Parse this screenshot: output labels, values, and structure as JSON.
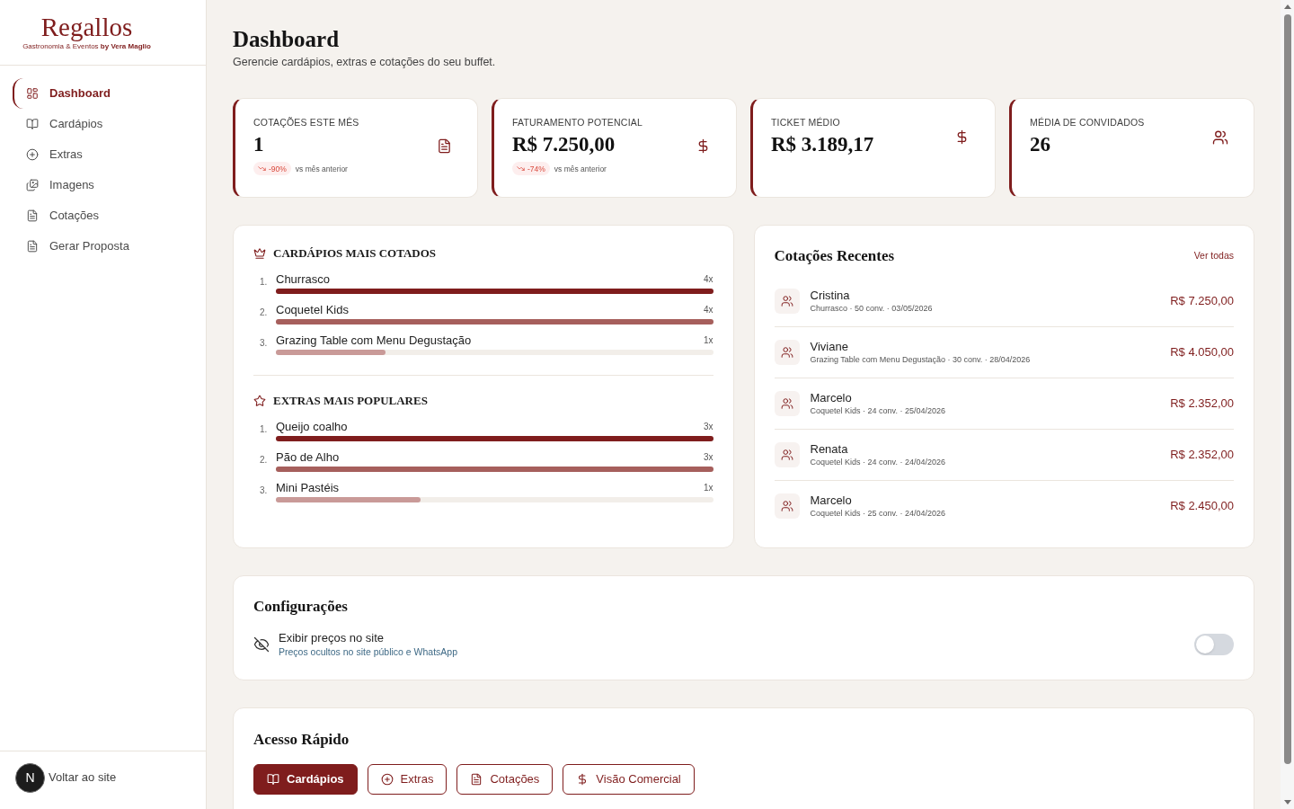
{
  "sidebar": {
    "logo": {
      "name": "Regallos",
      "tagline": "Gastronomia & Eventos **by Vera Maglio**"
    },
    "nav_items": [
      {
        "label": "Dashboard",
        "selected": true
      },
      {
        "label": "Cardápios",
        "selected": false
      },
      {
        "label": "Extras",
        "selected": false
      },
      {
        "label": "Imagens",
        "selected": false
      },
      {
        "label": "Cotações",
        "selected": false
      },
      {
        "label": "Gerar Proposta",
        "selected": false
      }
    ],
    "footer": {
      "back_link": "Voltar ao site"
    }
  },
  "dev_badge": "N",
  "header": {
    "title": "Dashboard",
    "subtitle": "Gerencie cardápios, extras e cotações do seu buffet."
  },
  "stat_cards": [
    {
      "kind": "quotes",
      "label": "COTAÇÕES ESTE MÊS",
      "value": "1",
      "change": "-90%",
      "change_caption": "vs mês anterior"
    },
    {
      "kind": "revenue",
      "label": "FATURAMENTO POTENCIAL",
      "value": "R$ 7.250,00",
      "change": "-74%",
      "change_caption": "vs mês anterior"
    },
    {
      "kind": "ticket",
      "label": "TICKET MÉDIO",
      "value": "R$ 3.189,17"
    },
    {
      "kind": "guests",
      "label": "MÉDIA DE CONVIDADOS",
      "value": "26"
    }
  ],
  "rankings": [
    {
      "kind": "menus",
      "title": "CARDÁPIOS MAIS COTADOS",
      "items": [
        {
          "rank": "1.",
          "name": "Churrasco",
          "count": "4x",
          "level": 1
        },
        {
          "rank": "2.",
          "name": "Coquetel Kids",
          "count": "4x",
          "level": 1
        },
        {
          "rank": "3.",
          "name": "Grazing Table com Menu Degustação",
          "count": "1x",
          "level": 0.25
        }
      ]
    },
    {
      "kind": "extras",
      "title": "EXTRAS MAIS POPULARES",
      "items": [
        {
          "rank": "1.",
          "name": "Queijo coalho",
          "count": "3x",
          "level": 1
        },
        {
          "rank": "2.",
          "name": "Pão de Alho",
          "count": "3x",
          "level": 1
        },
        {
          "rank": "3.",
          "name": "Mini Pastéis",
          "count": "1x",
          "level": 0.33
        }
      ]
    }
  ],
  "recent_quotes": {
    "title": "Cotações Recentes",
    "link": "Ver todas",
    "rows": [
      {
        "name": "Cristina",
        "details": "Churrasco · 50 conv. · 03/05/2026",
        "amount": "R$ 7.250,00"
      },
      {
        "name": "Viviane",
        "details": "Grazing Table com Menu Degustação · 30 conv. · 28/04/2026",
        "amount": "R$ 4.050,00"
      },
      {
        "name": "Marcelo",
        "details": "Coquetel Kids · 24 conv. · 25/04/2026",
        "amount": "R$ 2.352,00"
      },
      {
        "name": "Renata",
        "details": "Coquetel Kids · 24 conv. · 24/04/2026",
        "amount": "R$ 2.352,00"
      },
      {
        "name": "Marcelo",
        "details": "Coquetel Kids · 25 conv. · 24/04/2026",
        "amount": "R$ 2.450,00"
      }
    ]
  },
  "settings": {
    "title": "Configurações",
    "items": [
      {
        "label": "Exibir preços no site",
        "description": "Preços ocultos no site público e WhatsApp",
        "on": false
      }
    ]
  },
  "quick_access": {
    "title": "Acesso Rápido",
    "buttons": [
      {
        "kind": "menus",
        "label": "Cardápios",
        "primary": true
      },
      {
        "kind": "extras",
        "label": "Extras",
        "primary": false
      },
      {
        "kind": "quotes",
        "label": "Cotações",
        "primary": false
      },
      {
        "kind": "commercial",
        "label": "Visão Comercial",
        "primary": false
      }
    ]
  }
}
